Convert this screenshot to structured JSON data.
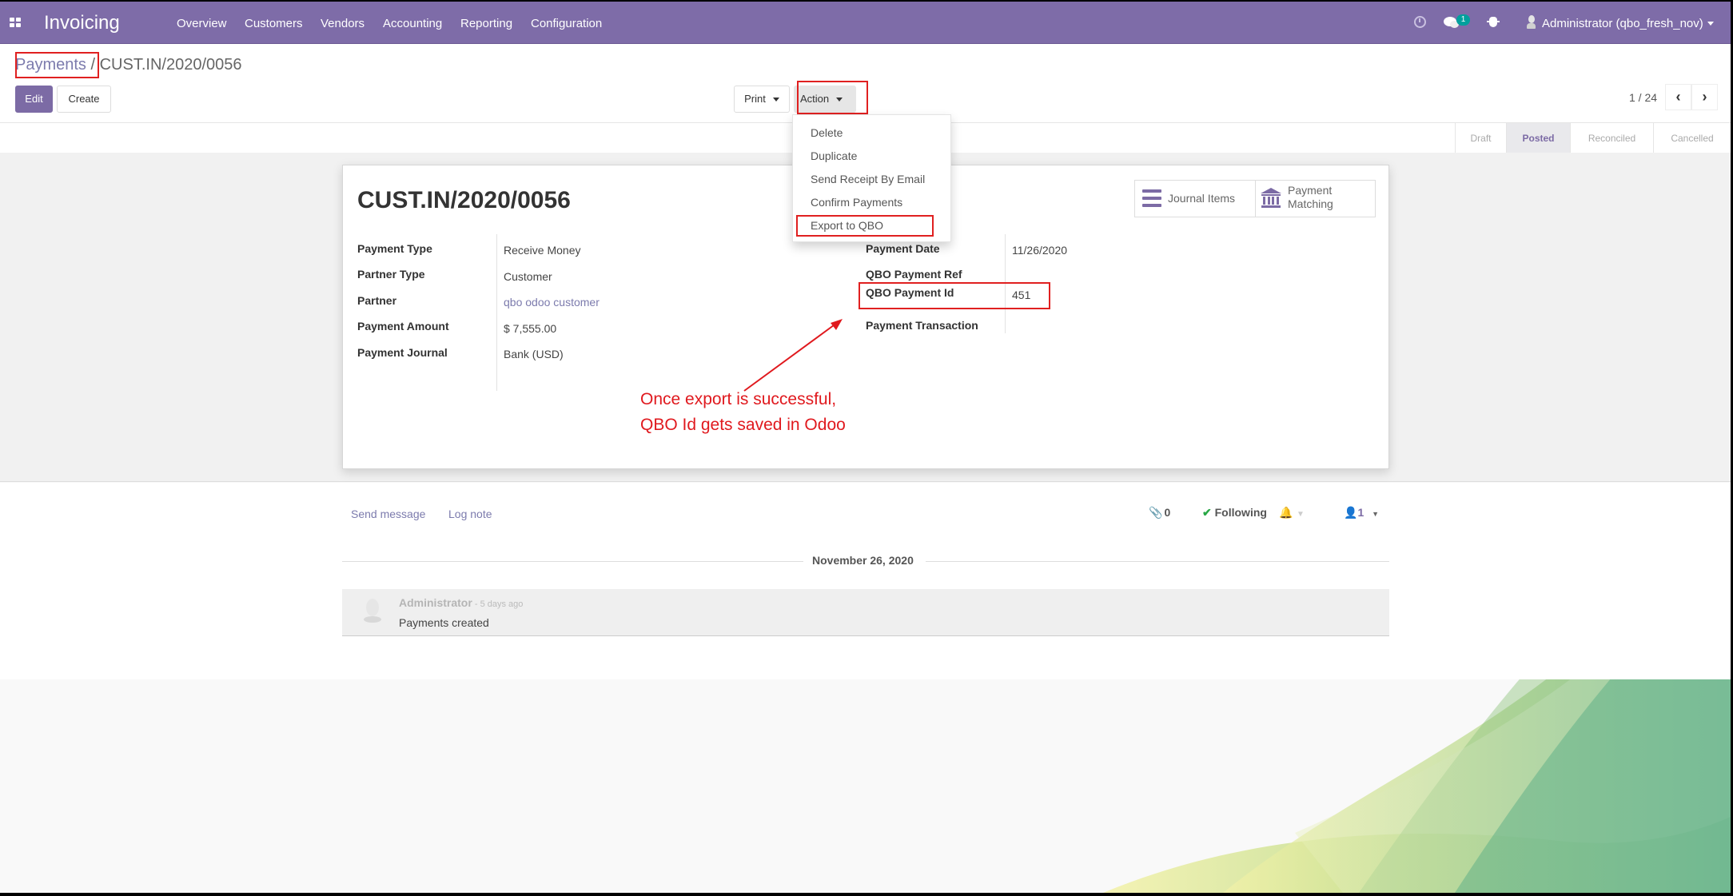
{
  "navbar": {
    "app_name": "Invoicing",
    "menu": [
      "Overview",
      "Customers",
      "Vendors",
      "Accounting",
      "Reporting",
      "Configuration"
    ],
    "icons": [
      "apps-grid-icon",
      "activity-clock-icon",
      "messages-icon",
      "debug-bug-icon",
      "user-avatar-icon"
    ],
    "message_badge": "1",
    "user": "Administrator (qbo_fresh_nov)",
    "bar_color": "#7e6ca8"
  },
  "breadcrumb": {
    "parent": "Payments",
    "separator": " / ",
    "current": "CUST.IN/2020/0056"
  },
  "buttons": {
    "edit": "Edit",
    "create": "Create",
    "print": "Print",
    "action": "Action"
  },
  "pager": {
    "value": "1 / 24",
    "prev": "‹",
    "next": "›"
  },
  "action_menu": {
    "items": [
      "Delete",
      "Duplicate",
      "Send Receipt By Email",
      "Confirm Payments",
      "Export to QBO"
    ],
    "highlighted": "Export to QBO"
  },
  "statusbar": {
    "states": [
      "Draft",
      "Posted",
      "Reconciled",
      "Cancelled"
    ],
    "active": "Posted"
  },
  "record": {
    "title": "CUST.IN/2020/0056",
    "left_fields": [
      {
        "label": "Payment Type",
        "value": "Receive Money"
      },
      {
        "label": "Partner Type",
        "value": "Customer"
      },
      {
        "label": "Partner",
        "value": "qbo odoo customer"
      },
      {
        "label": "Payment Amount",
        "value": "$ 7,555.00"
      },
      {
        "label": "Payment Journal",
        "value": "Bank (USD)"
      }
    ],
    "right_fields": [
      {
        "label": "Payment Date",
        "value": "11/26/2020"
      },
      {
        "label": "QBO Payment Ref",
        "value": ""
      },
      {
        "label": "QBO Payment Id",
        "value": "451"
      },
      {
        "label": "Payment Transaction",
        "value": ""
      }
    ],
    "smart_buttons": {
      "journal_items": "Journal Items",
      "payment_matching_line1": "Payment",
      "payment_matching_line2": "Matching"
    }
  },
  "annotation": {
    "line1": "Once export is successful,",
    "line2": "QBO Id gets saved in Odoo",
    "color": "#e0191e"
  },
  "chatter": {
    "send_message": "Send message",
    "log_note": "Log note",
    "attachments_count": "0",
    "following": "Following",
    "followers_count": "1",
    "date_separator": "November 26, 2020",
    "messages": [
      {
        "author": "Administrator",
        "time": " - 5 days ago",
        "body": "Payments created"
      }
    ]
  }
}
